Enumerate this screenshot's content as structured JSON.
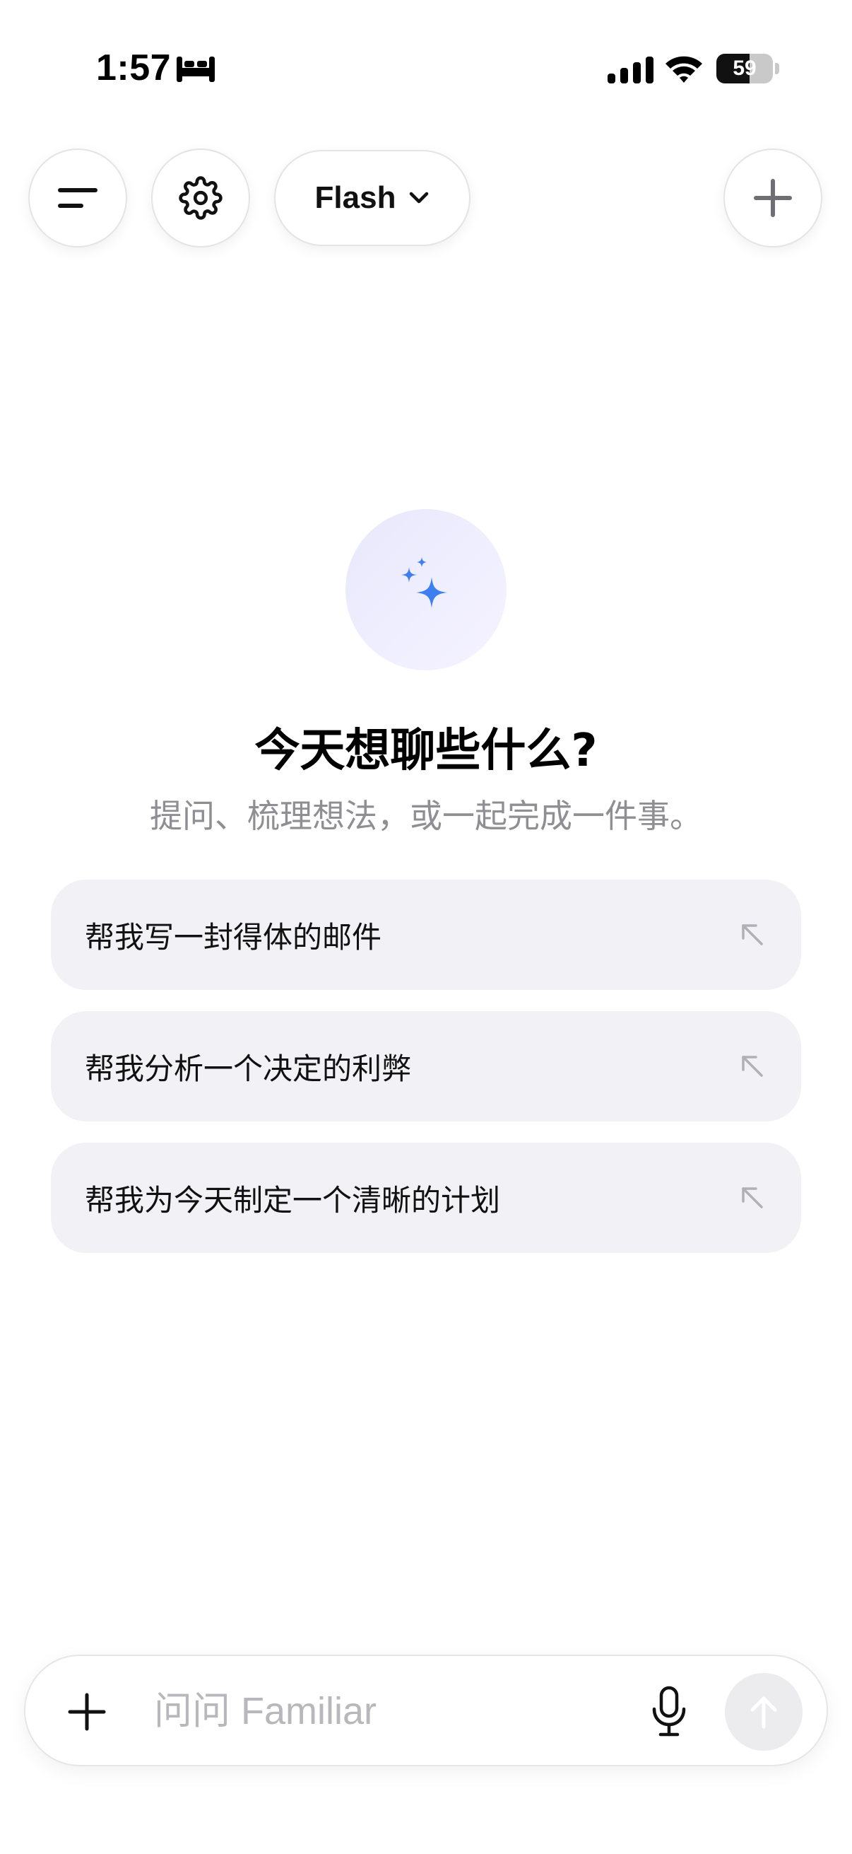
{
  "status_bar": {
    "time": "1:57",
    "battery_level": "59",
    "icons": [
      "bed-icon",
      "cellular-signal-icon",
      "wifi-icon",
      "battery-icon"
    ]
  },
  "toolbar": {
    "menu_icon": "menu-lines-icon",
    "settings_icon": "gear-icon",
    "model_label": "Flash",
    "model_icon": "chevron-down-icon",
    "new_chat_icon": "plus-icon"
  },
  "hero": {
    "icon": "sparkles-icon",
    "title": "今天想聊些什么?",
    "subtitle": "提问、梳理想法，或一起完成一件事。"
  },
  "suggestions": [
    {
      "label": "帮我写一封得体的邮件",
      "icon": "arrow-up-left-icon"
    },
    {
      "label": "帮我分析一个决定的利弊",
      "icon": "arrow-up-left-icon"
    },
    {
      "label": "帮我为今天制定一个清晰的计划",
      "icon": "arrow-up-left-icon"
    }
  ],
  "composer": {
    "placeholder": "问问 Familiar",
    "value": "",
    "attach_icon": "plus-icon",
    "mic_icon": "microphone-icon",
    "send_icon": "arrow-up-icon"
  },
  "colors": {
    "accent": "#3d7ff0",
    "suggestion_bg": "#f1f1f6",
    "subtitle": "#8e8e93",
    "placeholder": "#b7b7bc",
    "send_disabled": "#ececef"
  }
}
